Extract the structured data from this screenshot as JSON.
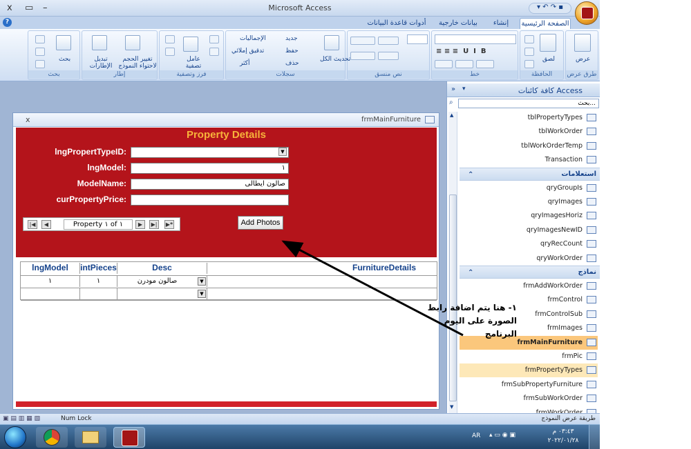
{
  "window": {
    "title": "Microsoft Access"
  },
  "tabs": [
    "الصفحة الرئيسية",
    "إنشاء",
    "بيانات خارجية",
    "أدوات قاعدة البيانات"
  ],
  "ribbon": {
    "groups": [
      {
        "label": "طرق عرض",
        "items": [
          "عرض"
        ]
      },
      {
        "label": "الحافظة",
        "items": [
          "لصق"
        ]
      },
      {
        "label": "خط",
        "items": []
      },
      {
        "label": "نص منسق",
        "items": []
      },
      {
        "label": "سجلات",
        "items": [
          "جديد",
          "حفظ",
          "حذف",
          "تحديث الكل",
          "الإجماليات",
          "تدقيق إملائي",
          "أكثر"
        ]
      },
      {
        "label": "فرز وتصفية",
        "items": [
          "عامل تصفية"
        ]
      },
      {
        "label": "إطار",
        "items": [
          "تغيير الحجم لاحتواء النموذج",
          "تبديل الإطارات"
        ]
      },
      {
        "label": "بحث",
        "items": [
          "بحث"
        ]
      }
    ]
  },
  "form": {
    "window_name": "frmMainFurniture",
    "heading": "Property Details",
    "fields": [
      {
        "label": "lngPropertTypeID:",
        "value": ""
      },
      {
        "label": "lngModel:",
        "value": "١"
      },
      {
        "label": "ModelName:",
        "value": "صالون ايطالى"
      },
      {
        "label": "curPropertyPrice:",
        "value": ""
      }
    ],
    "navigator": {
      "text": "Property ١ of ١"
    },
    "add_photos_label": "Add Photos",
    "subform": {
      "columns": [
        "lngModel",
        "intPieces",
        "Desc",
        "FurnitureDetails"
      ],
      "rows": [
        [
          "١",
          "١",
          "صالون مودرن",
          ""
        ]
      ]
    }
  },
  "navpane": {
    "title": "كافة كائنات Access",
    "search_placeholder": "بحث...",
    "tables": [
      "tblPropertyTypes",
      "tblWorkOrder",
      "tblWorkOrderTemp",
      "Transaction"
    ],
    "queries_label": "استعلامات",
    "queries": [
      "qryGroupIs",
      "qryImages",
      "qryImagesHoriz",
      "qryImagesNewID",
      "qryRecCount",
      "qryWorkOrder"
    ],
    "forms_label": "نماذج",
    "forms": [
      "frmAddWorkOrder",
      "frmControl",
      "frmControlSub",
      "frmImages",
      "frmMainFurniture",
      "frmPic",
      "frmPropertyTypes",
      "frmSubPropertyFurniture",
      "frmSubWorkOrder",
      "frmWorkOrder"
    ],
    "selected": "frmMainFurniture"
  },
  "statusbar": {
    "left": "Num Lock",
    "right": "طريقة عرض النموذج"
  },
  "taskbar": {
    "lang": "AR",
    "time": "٠٣:٤٣ م",
    "date": "٢٠٢٢/٠١/٢٨"
  },
  "annotation": "١- هنا يتم اضافة رابط الصورة على اليوم البرنامج"
}
